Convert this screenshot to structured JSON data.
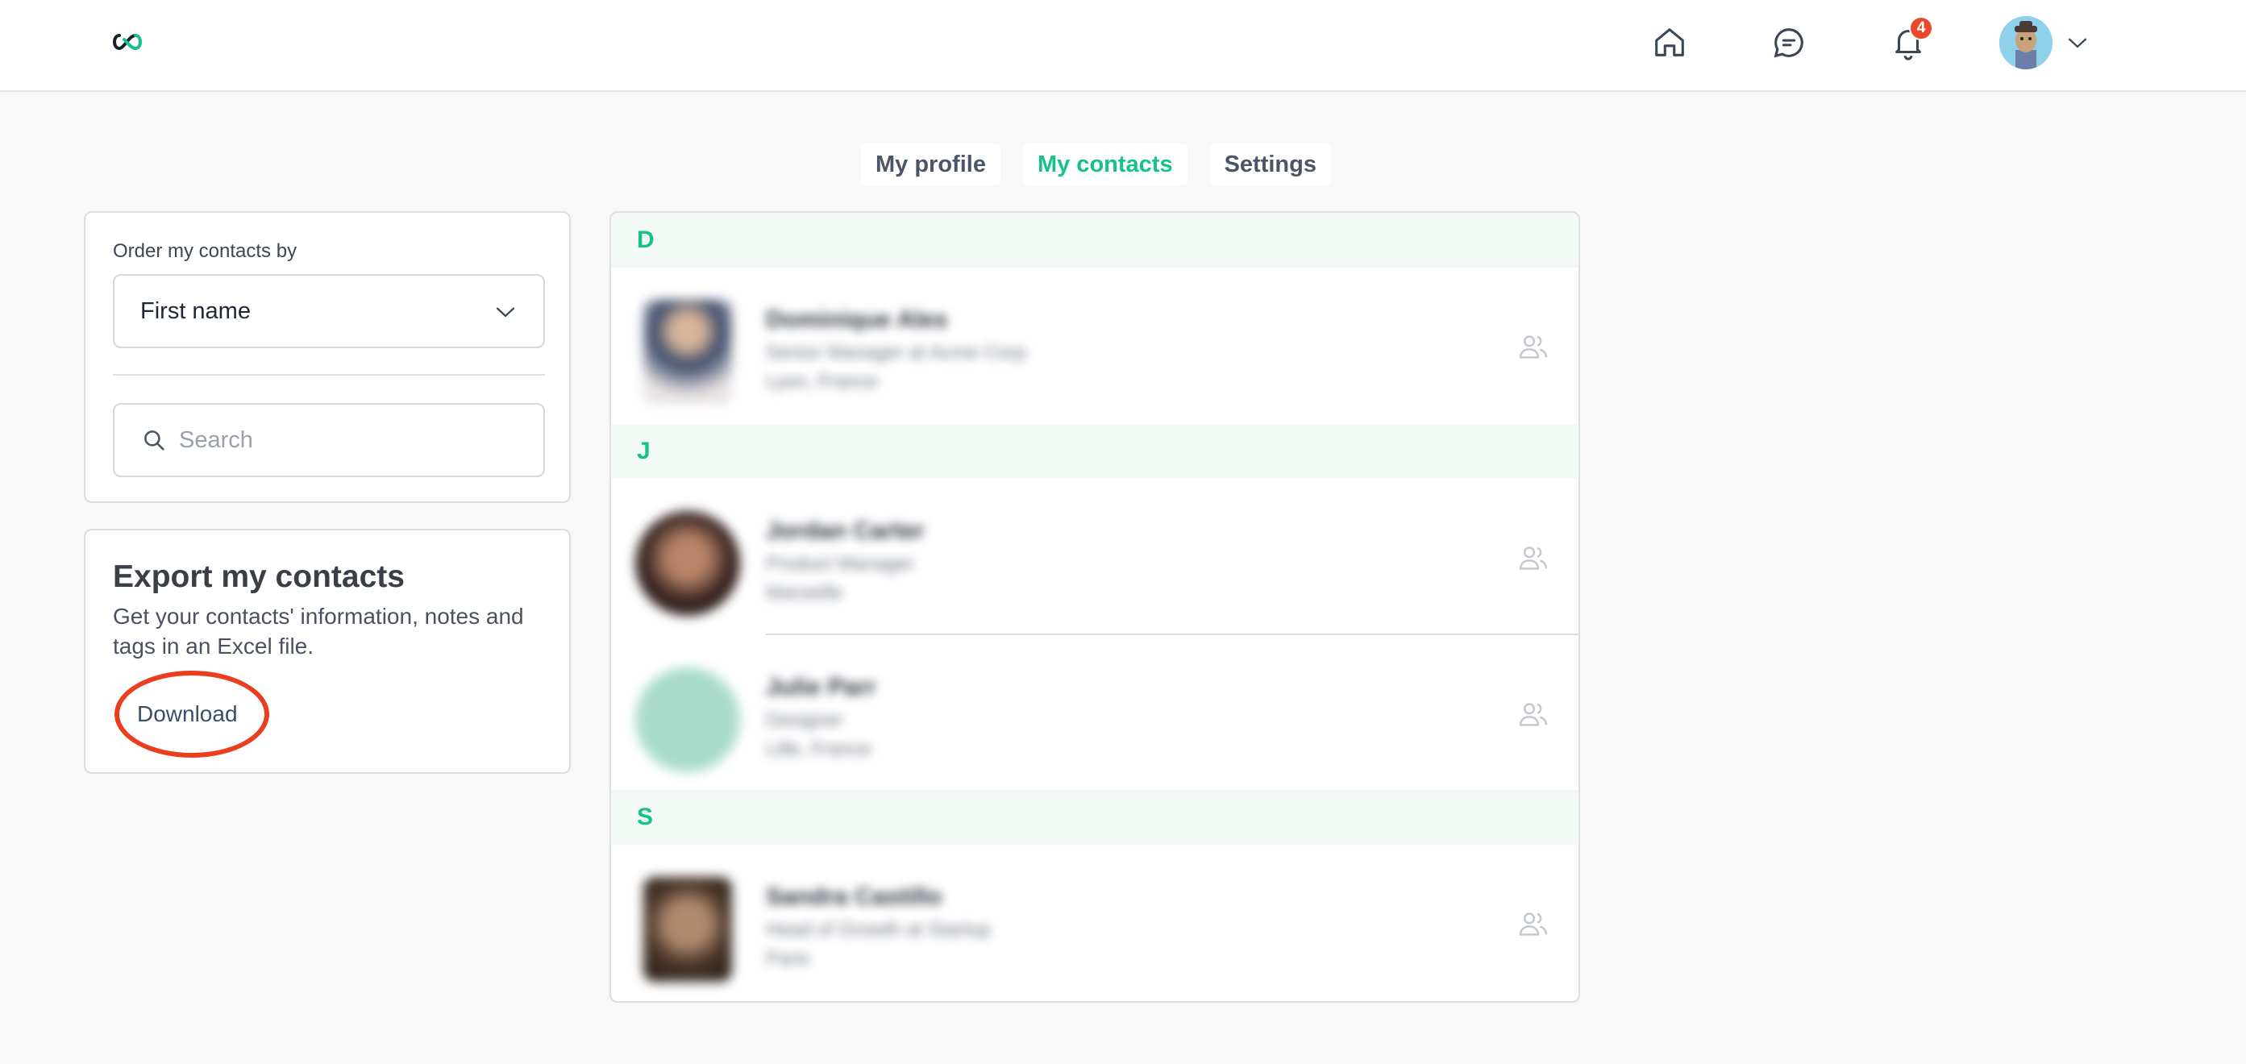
{
  "header": {
    "logo_icon": "infinity-logo-icon",
    "icons": [
      "home-icon",
      "chat-icon",
      "bell-icon"
    ],
    "notification_count": "4",
    "brand_color": "#17c28a"
  },
  "tabs": [
    {
      "label": "My profile",
      "active": false
    },
    {
      "label": "My contacts",
      "active": true
    },
    {
      "label": "Settings",
      "active": false
    }
  ],
  "filter": {
    "order_label": "Order my contacts by",
    "order_value": "First name",
    "search_placeholder": "Search"
  },
  "export": {
    "title": "Export my contacts",
    "description": "Get your contacts' information, notes and tags in an Excel file.",
    "download_label": "Download",
    "highlight_color": "#ea3f1f"
  },
  "contacts": {
    "groups": [
      {
        "letter": "D"
      },
      {
        "letter": "J"
      },
      {
        "letter": "S"
      }
    ],
    "rows": [
      {
        "name": "Dominique Ales",
        "line1": "Senior Manager at Acme Corp",
        "line2": "Lyon, France"
      },
      {
        "name": "Jordan Carter",
        "line1": "Product Manager",
        "line2": "Marseille"
      },
      {
        "name": "Julie Parr",
        "line1": "Designer",
        "line2": "Lille, France"
      },
      {
        "name": "Sandra Castillo",
        "line1": "Head of Growth at Startup",
        "line2": "Paris"
      }
    ]
  }
}
